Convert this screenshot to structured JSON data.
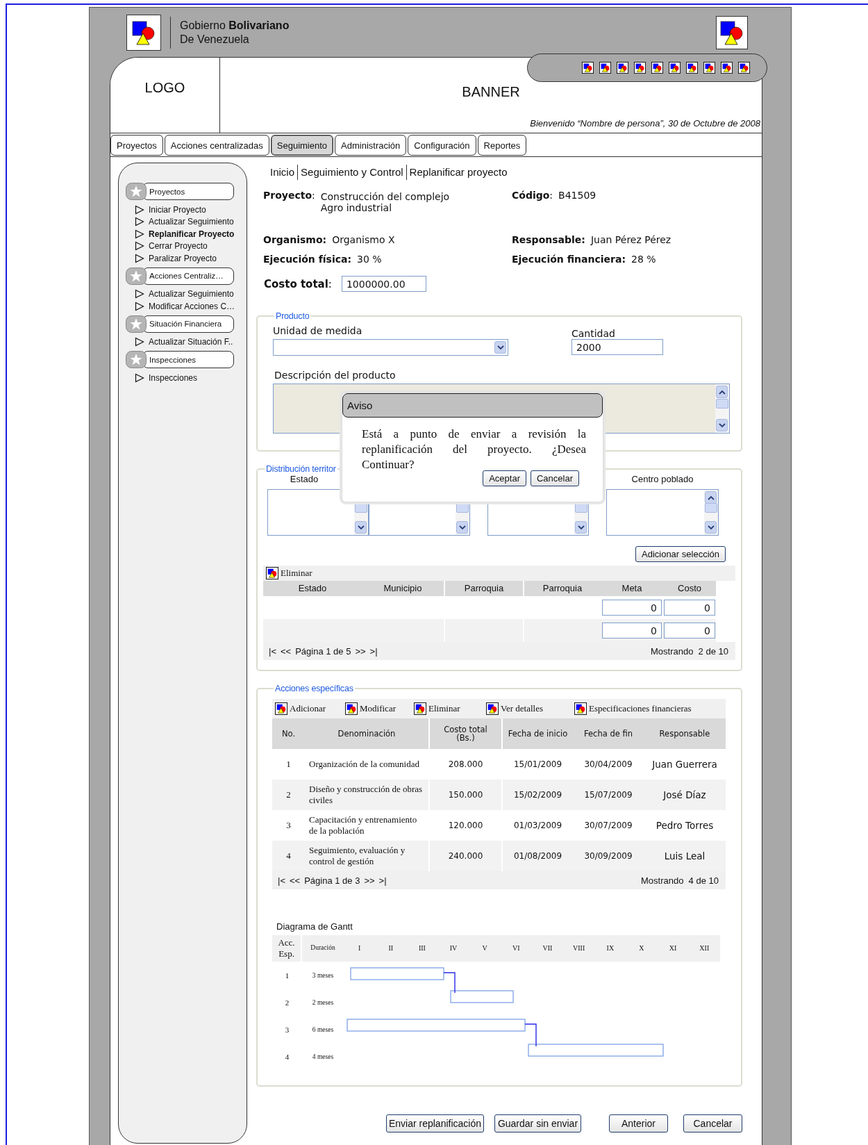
{
  "header": {
    "org_name": "Gobierno **Bolivariano**",
    "org_subtitle": "De Venezuela"
  },
  "logo": "LOGO",
  "banner": "BANNER",
  "welcome": "Bienvenido “Nombre de persona”, 30 de Octubre de 2008",
  "tabs": [
    {
      "label": "Proyectos",
      "selected": false
    },
    {
      "label": "Acciones centralizadas",
      "selected": false
    },
    {
      "label": "Seguimiento",
      "selected": true
    },
    {
      "label": "Administración",
      "selected": false
    },
    {
      "label": "Configuración",
      "selected": false
    },
    {
      "label": "Reportes",
      "selected": false
    }
  ],
  "sidebar": {
    "groups": [
      {
        "title": "Proyectos",
        "items": [
          {
            "label": "Iniciar Proyecto",
            "selected": false
          },
          {
            "label": "Actualizar Seguimiento",
            "selected": false
          },
          {
            "label": "Replanificar Proyecto",
            "selected": true
          },
          {
            "label": "Cerrar Proyecto",
            "selected": false
          },
          {
            "label": "Paralizar Proyecto",
            "selected": false
          }
        ]
      },
      {
        "title": "Acciones Centraliz…",
        "items": [
          {
            "label": "Actualizar Seguimiento",
            "selected": false
          },
          {
            "label": "Modificar Acciones C…",
            "selected": false
          }
        ]
      },
      {
        "title": "Situación Financiera",
        "items": [
          {
            "label": "Actualizar Situación F..",
            "selected": false
          }
        ]
      },
      {
        "title": "Inspecciones",
        "items": [
          {
            "label": "Inspecciones",
            "selected": false
          }
        ]
      }
    ]
  },
  "breadcrumb": [
    "Inicio",
    "Seguimiento y Control",
    "Replanificar proyecto"
  ],
  "project": {
    "rows": [
      [
        {
          "label": "**Proyecto**:",
          "value": "Construcción del complejo Agro industrial"
        },
        {
          "label": "**Código**:",
          "value": "B41509"
        }
      ],
      [
        {
          "label": "**Organismo:**",
          "value": "Organismo X"
        },
        {
          "label": "**Responsable:**",
          "value": "Juan Pérez Pérez"
        }
      ],
      [
        {
          "label": "**Ejecución física:**",
          "value": "30 %"
        },
        {
          "label": "**Ejecución financiera:**",
          "value": "28 %"
        }
      ]
    ],
    "cost_label": "**Costo total**:",
    "cost_value": "1000000.00"
  },
  "product": {
    "legend": "Producto",
    "unit_label": "Unidad de medida",
    "quantity_label": "Cantidad",
    "quantity_value": "2000",
    "description_label": "Descripción del producto"
  },
  "distribution": {
    "legend": "Distribución territor",
    "first_list_label": "Estado",
    "last_list_label": "Centro poblado",
    "add_button": "Adicionar selección",
    "delete_action": "Eliminar",
    "columns": [
      "Estado",
      "Municipio",
      "Parroquia",
      "Parroquia",
      "Meta",
      "Costo"
    ],
    "rows": [
      {
        "meta": "0",
        "cost": "0"
      },
      {
        "meta": "0",
        "cost": "0"
      }
    ],
    "pager": [
      "|<",
      "<<",
      "Página 1 de 5",
      ">>",
      ">|"
    ],
    "showing": "Mostrando  2 de 10"
  },
  "actions": {
    "legend": "Acciones específicas",
    "toolbar": [
      "Adicionar",
      "Modificar",
      "Eliminar",
      "Ver detalles",
      "Especificaciones financieras"
    ],
    "columns": [
      "No.",
      "Denominación",
      "Costo total (Bs.)",
      "Fecha de inicio",
      "Fecha de fin",
      "Responsable"
    ],
    "rows": [
      {
        "no": "1",
        "name": "Organización de la comunidad",
        "cost": "208.000",
        "start": "15/01/2009",
        "end": "30/04/2009",
        "owner": "Juan Guerrera"
      },
      {
        "no": "2",
        "name": "Diseño y construcción de obras civiles",
        "cost": "150.000",
        "start": "15/02/2009",
        "end": "15/07/2009",
        "owner": "José Díaz"
      },
      {
        "no": "3",
        "name": "Capacitación y entrenamiento de la población",
        "cost": "120.000",
        "start": "01/03/2009",
        "end": "30/07/2009",
        "owner": "Pedro Torres"
      },
      {
        "no": "4",
        "name": "Seguimiento, evaluación y control de gestión",
        "cost": "240.000",
        "start": "01/08/2009",
        "end": "30/09/2009",
        "owner": "Luis Leal"
      }
    ],
    "pager": [
      "|<",
      "<<",
      "Página 1 de 3",
      ">>",
      ">|"
    ],
    "showing": "Mostrando  4 de 10"
  },
  "gantt": {
    "title": "Diagrama de Gantt",
    "head": [
      "Acc. Esp.",
      "Duración"
    ],
    "months": [
      "I",
      "II",
      "III",
      "IV",
      "V",
      "VI",
      "VII",
      "VIII",
      "IX",
      "X",
      "XI",
      "XII"
    ],
    "rows": [
      {
        "no": "1",
        "duration": "3 meses"
      },
      {
        "no": "2",
        "duration": "2 meses"
      },
      {
        "no": "3",
        "duration": "6 meses"
      },
      {
        "no": "4",
        "duration": "4 meses"
      }
    ]
  },
  "buttons": [
    "Enviar replanificación",
    "Guardar sin enviar",
    "Anterior",
    "Cancelar"
  ],
  "dialog": {
    "title": "Aviso",
    "message": "Está a punto de enviar a revisión la replanificación del proyecto. ¿Desea Continuar?",
    "buttons": [
      "Aceptar",
      "Cancelar"
    ]
  }
}
